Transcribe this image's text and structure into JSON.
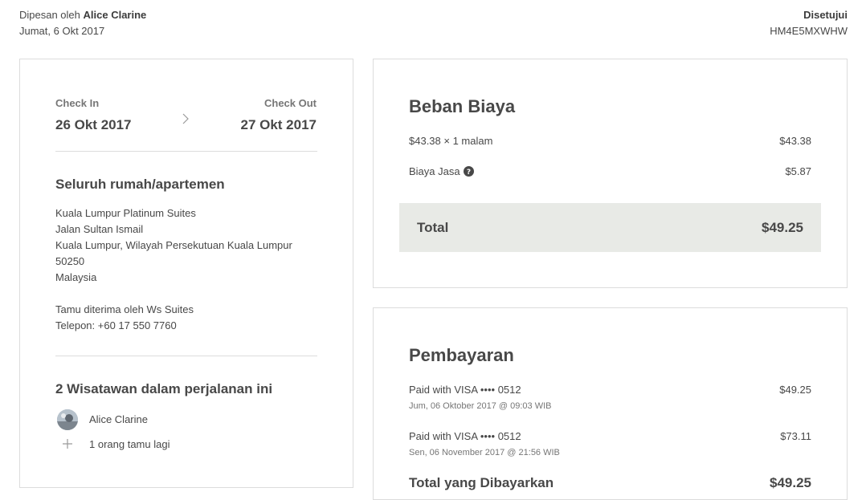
{
  "header": {
    "ordered_by_prefix": "Dipesan oleh",
    "ordered_by_name": "Alice Clarine",
    "order_date": "Jumat, 6 Okt 2017",
    "status": "Disetujui",
    "confirmation_code": "HM4E5MXWHW"
  },
  "stay": {
    "check_in_label": "Check In",
    "check_in_date": "26 Okt 2017",
    "check_out_label": "Check Out",
    "check_out_date": "27 Okt 2017",
    "room_type": "Seluruh rumah/apartemen",
    "address": [
      "Kuala Lumpur Platinum Suites",
      "Jalan Sultan Ismail",
      "Kuala Lumpur, Wilayah Persekutuan Kuala Lumpur",
      "50250",
      "Malaysia"
    ],
    "host_line": "Tamu diterima oleh Ws Suites",
    "phone_line": "Telepon: +60 17 550 7760",
    "travelers_title": "2 Wisatawan dalam perjalanan ini",
    "traveler_name": "Alice Clarine",
    "more_guests": "1 orang tamu lagi"
  },
  "charges": {
    "title": "Beban Biaya",
    "line1_label": "$43.38 × 1 malam",
    "line1_value": "$43.38",
    "line2_label": "Biaya Jasa",
    "line2_value": "$5.87",
    "total_label": "Total",
    "total_value": "$49.25"
  },
  "payments": {
    "title": "Pembayaran",
    "items": [
      {
        "label": "Paid with VISA •••• 0512",
        "date": "Jum, 06 Oktober 2017 @ 09:03 WIB",
        "amount": "$49.25"
      },
      {
        "label": "Paid with VISA •••• 0512",
        "date": "Sen, 06 November 2017 @ 21:56 WIB",
        "amount": "$73.11"
      }
    ],
    "total_label": "Total yang Dibayarkan",
    "total_value": "$49.25"
  },
  "icons": {
    "chevron": "chevron-right-icon",
    "help": "question-circle-icon",
    "plus": "plus-icon",
    "avatar": "avatar"
  }
}
